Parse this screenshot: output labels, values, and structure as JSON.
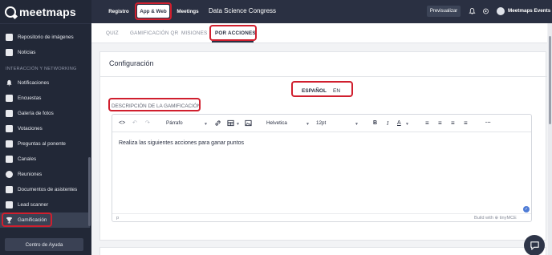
{
  "app": {
    "logo_text": "meetmaps"
  },
  "sidebar": {
    "items_top": [
      {
        "label": "Repositorio de imágenes",
        "icon": "images-icon"
      },
      {
        "label": "Noticias",
        "icon": "news-icon"
      }
    ],
    "section_label": "INTERACCIÓN Y NETWORKING",
    "items": [
      {
        "label": "Notificaciones",
        "icon": "bell-icon"
      },
      {
        "label": "Encuestas",
        "icon": "survey-icon"
      },
      {
        "label": "Galería de fotos",
        "icon": "photo-gallery-icon"
      },
      {
        "label": "Votaciones",
        "icon": "votes-icon"
      },
      {
        "label": "Preguntas al ponente",
        "icon": "questions-icon"
      },
      {
        "label": "Canales",
        "icon": "channels-icon"
      },
      {
        "label": "Reuniones",
        "icon": "meetings-icon"
      },
      {
        "label": "Documentos de asistentes",
        "icon": "documents-icon"
      },
      {
        "label": "Lead scanner",
        "icon": "lead-scanner-icon"
      },
      {
        "label": "Gamificación",
        "icon": "trophy-icon",
        "active": true
      }
    ],
    "help_button": "Centro de Ayuda"
  },
  "topbar": {
    "tabs": [
      "Registro",
      "App & Web",
      "Meetings"
    ],
    "active_tab": "App & Web",
    "event_title": "Data Science Congress",
    "preview_button": "Previsualizar",
    "user_name": "Meetmaps Events"
  },
  "subtabs": {
    "items": [
      "QUIZ",
      "GAMIFICACIÓN QR",
      "MISIONES",
      "POR ACCIONES"
    ],
    "active": "POR ACCIONES"
  },
  "config": {
    "title": "Configuración",
    "languages": [
      "ESPAÑOL",
      "EN"
    ],
    "active_language": "ESPAÑOL",
    "field_label": "DESCRIPCIÓN DE LA GAMIFICACIÓN"
  },
  "editor": {
    "block_format": "Párrafo",
    "font_family": "Helvetica",
    "font_size": "12pt",
    "content": "Realiza las siguientes acciones para ganar puntos",
    "status_path": "p",
    "powered_by": "Build with ⊕ tinyMCE",
    "text_color": "#2a3042"
  },
  "colors": {
    "sidebar_bg": "#222837",
    "topbar_bg": "#2a3042",
    "highlight_ring": "#d01f2e",
    "accent_blue": "#4f7cd6"
  }
}
